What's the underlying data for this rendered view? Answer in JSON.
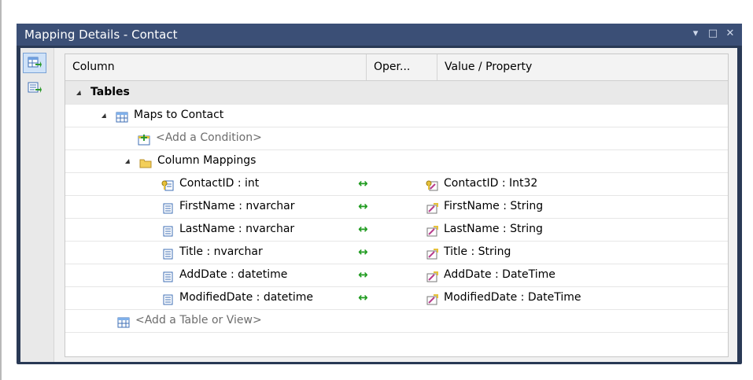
{
  "window": {
    "title": "Mapping Details - Contact",
    "controls": [
      "▾",
      "□",
      "✕"
    ]
  },
  "grid": {
    "columns": [
      "Column",
      "Oper...",
      "Value / Property"
    ],
    "tables_label": "Tables",
    "maps_to": "Maps to Contact",
    "add_condition": "<Add a Condition>",
    "column_mappings": "Column Mappings",
    "mappings": [
      {
        "column": "ContactID : int",
        "op": "↔",
        "property": "ContactID : Int32",
        "key": true
      },
      {
        "column": "FirstName : nvarchar",
        "op": "↔",
        "property": "FirstName : String",
        "key": false
      },
      {
        "column": "LastName : nvarchar",
        "op": "↔",
        "property": "LastName : String",
        "key": false
      },
      {
        "column": "Title : nvarchar",
        "op": "↔",
        "property": "Title : String",
        "key": false
      },
      {
        "column": "AddDate : datetime",
        "op": "↔",
        "property": "AddDate : DateTime",
        "key": false
      },
      {
        "column": "ModifiedDate : datetime",
        "op": "↔",
        "property": "ModifiedDate : DateTime",
        "key": false
      }
    ],
    "add_table": "<Add a Table or View>"
  },
  "colors": {
    "titlebar": "#3b4f76",
    "frame": "#293955",
    "map_arrow": "#1f9b1f"
  }
}
